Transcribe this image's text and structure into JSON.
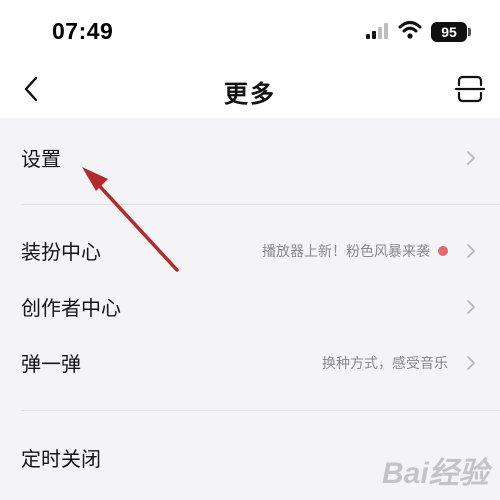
{
  "status_bar": {
    "time": "07:49",
    "battery_level": "95",
    "signal_icon": "signal-bars-icon",
    "wifi_icon": "wifi-icon"
  },
  "nav": {
    "title": "更多",
    "back_icon": "back-chevron-icon",
    "scan_icon": "scan-icon"
  },
  "rows": [
    {
      "label": "设置",
      "hint": "",
      "dot": false
    },
    {
      "label": "装扮中心",
      "hint": "播放器上新！粉色风暴来袭",
      "dot": true
    },
    {
      "label": "创作者中心",
      "hint": "",
      "dot": false
    },
    {
      "label": "弹一弹",
      "hint": "换种方式，感受音乐",
      "dot": false
    },
    {
      "label": "定时关闭",
      "hint": "",
      "dot": false
    }
  ],
  "colors": {
    "background": "#f4f4f6",
    "header": "#ffffff",
    "annotation_arrow": "#b32a2a",
    "dot": "#e26a6a"
  },
  "watermark": {
    "text": "Bai经验"
  }
}
